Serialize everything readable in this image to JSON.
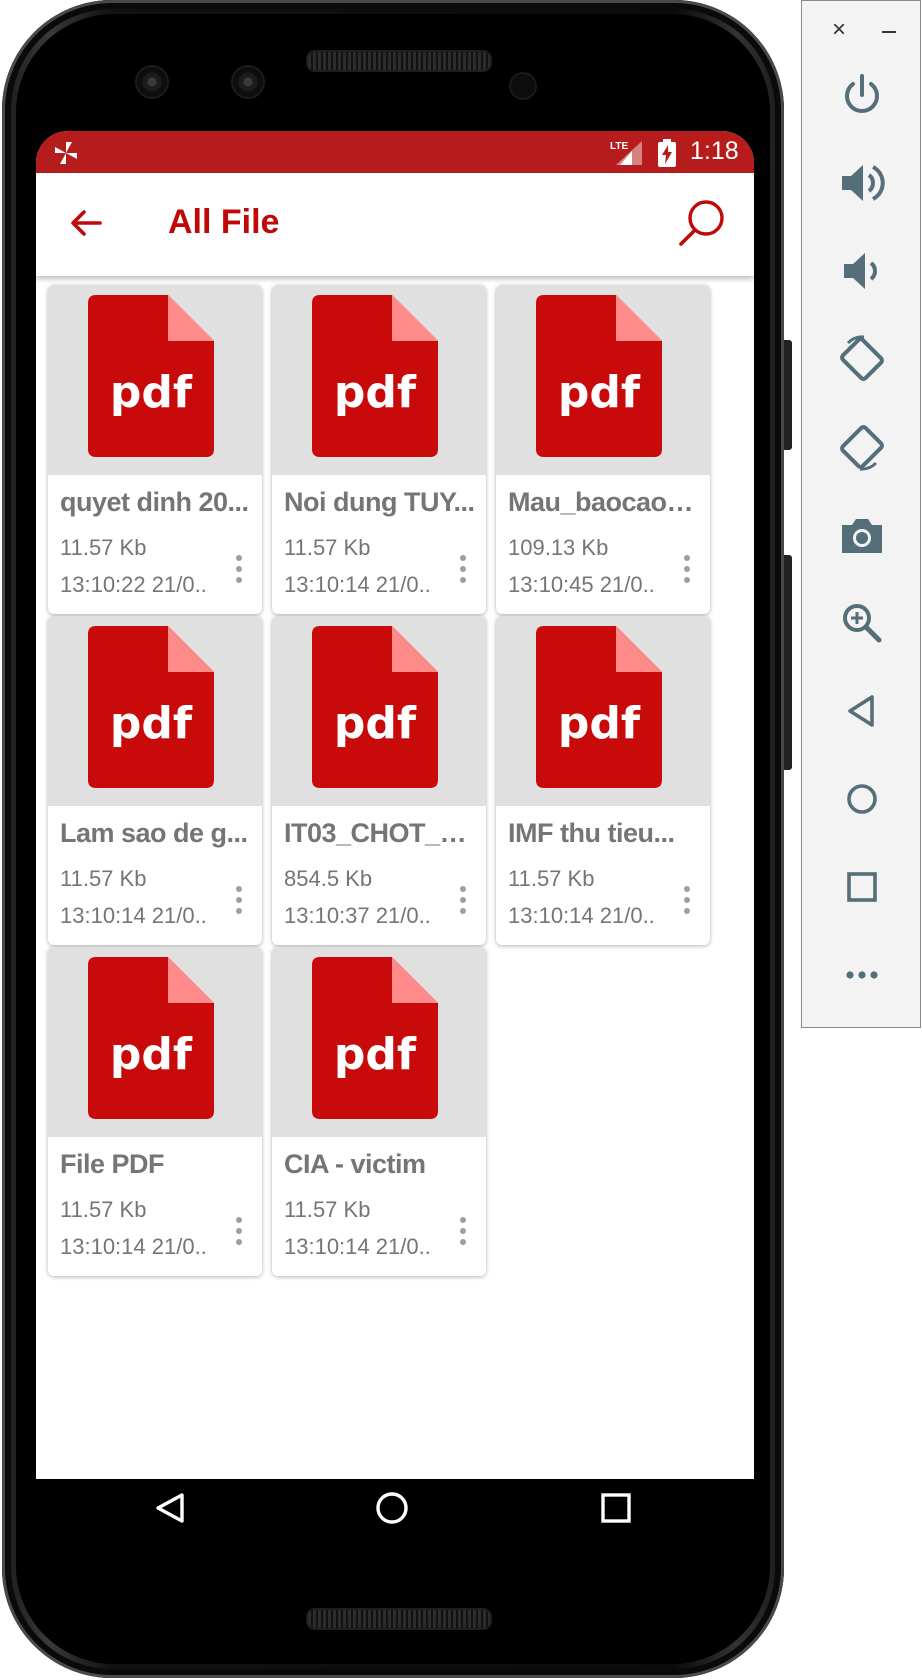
{
  "status_bar": {
    "time": "1:18",
    "network": "LTE"
  },
  "app_bar": {
    "title": "All File"
  },
  "files": [
    {
      "name": "quyet dinh 20...",
      "size": "11.57 Kb",
      "date": "13:10:22 21/0.."
    },
    {
      "name": "Noi dung TUY...",
      "size": "11.57 Kb",
      "date": "13:10:14 21/0.."
    },
    {
      "name": "Mau_baocao_...",
      "size": "109.13 Kb",
      "date": "13:10:45 21/0.."
    },
    {
      "name": "Lam sao de g...",
      "size": "11.57 Kb",
      "date": "13:10:14 21/0.."
    },
    {
      "name": "IT03_CHOT_H...",
      "size": "854.5 Kb",
      "date": "13:10:37 21/0.."
    },
    {
      "name": "IMF thu tieu...",
      "size": "11.57 Kb",
      "date": "13:10:14 21/0.."
    },
    {
      "name": "File PDF",
      "size": "11.57 Kb",
      "date": "13:10:14 21/0.."
    },
    {
      "name": "CIA - victim",
      "size": "11.57 Kb",
      "date": "13:10:14 21/0.."
    }
  ],
  "file_icon_label": "pdf",
  "colors": {
    "accent": "#c00808",
    "status_bar": "#b71c1c",
    "pdf_red": "#c80a0a",
    "pdf_corner": "#ff8a8a",
    "thumb_bg": "#e0e0e0",
    "text_grey": "#757575"
  },
  "icons": {
    "back": "arrow-left-icon",
    "search": "search-icon",
    "more": "more-vert-icon"
  },
  "emulator_panel": {
    "tools": [
      "power-icon",
      "volume-up-icon",
      "volume-down-icon",
      "rotate-left-icon",
      "rotate-right-icon",
      "camera-icon",
      "zoom-icon",
      "back-icon",
      "home-icon",
      "overview-icon",
      "more-icon"
    ]
  }
}
